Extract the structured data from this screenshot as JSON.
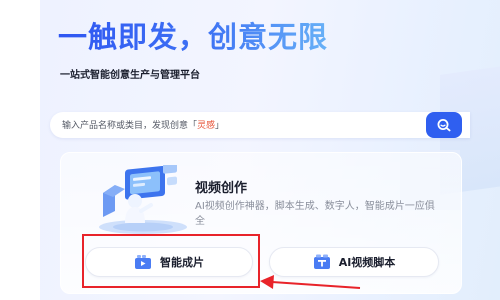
{
  "hero": {
    "title": "一触即发，创意无限",
    "subtitle": "一站式智能创意生产与管理平台"
  },
  "search": {
    "placeholder_prefix": "输入产品名称或类目，发现创意「",
    "placeholder_highlight": "灵感",
    "placeholder_suffix": "」",
    "button_icon": "search-icon"
  },
  "card": {
    "title": "视频创作",
    "description": "AI视频创作神器，脚本生成、数字人，智能成片一应俱全",
    "illustration": "video-creation-illustration",
    "buttons": [
      {
        "label": "智能成片",
        "icon": "film-icon"
      },
      {
        "label": "AI视频脚本",
        "icon": "script-icon"
      }
    ]
  },
  "annotation": {
    "highlight_color": "#e8232a",
    "target": "智能成片"
  },
  "colors": {
    "accent": "#2f5ff0",
    "title_gradient_start": "#2f56f2",
    "title_gradient_end": "#68b1f7",
    "placeholder_highlight": "#e8553a"
  }
}
